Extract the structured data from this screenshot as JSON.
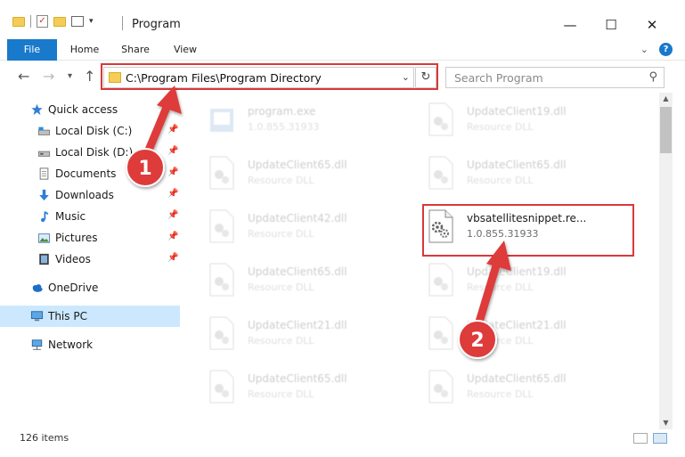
{
  "window": {
    "title": "Program",
    "minimize": "—",
    "maximize": "☐",
    "close": "✕"
  },
  "ribbon": {
    "tabs": [
      "File",
      "Home",
      "Share",
      "View"
    ]
  },
  "address": {
    "path": "C:\\Program Files\\Program Directory",
    "search_placeholder": "Search Program"
  },
  "sidebar": {
    "items": [
      {
        "label": "Quick access",
        "icon": "star-icon"
      },
      {
        "label": "Local Disk (C:)",
        "icon": "drive-icon"
      },
      {
        "label": "Local Disk (D:)",
        "icon": "drive-icon"
      },
      {
        "label": "Documents",
        "icon": "documents-icon"
      },
      {
        "label": "Downloads",
        "icon": "download-icon"
      },
      {
        "label": "Music",
        "icon": "music-icon"
      },
      {
        "label": "Pictures",
        "icon": "pictures-icon"
      },
      {
        "label": "Videos",
        "icon": "videos-icon"
      },
      {
        "label": "OneDrive",
        "icon": "cloud-icon"
      },
      {
        "label": "This PC",
        "icon": "computer-icon"
      },
      {
        "label": "Network",
        "icon": "network-icon"
      }
    ]
  },
  "files": {
    "left": [
      {
        "name": "program.exe",
        "sub": "1.0.855.31933"
      },
      {
        "name": "UpdateClient65.dll",
        "sub": "Resource DLL"
      },
      {
        "name": "UpdateClient42.dll",
        "sub": "Resource DLL"
      },
      {
        "name": "UpdateClient65.dll",
        "sub": "Resource DLL"
      },
      {
        "name": "UpdateClient21.dll",
        "sub": "Resource DLL"
      },
      {
        "name": "UpdateClient65.dll",
        "sub": "Resource DLL"
      }
    ],
    "right": [
      {
        "name": "UpdateClient19.dll",
        "sub": "Resource DLL"
      },
      {
        "name": "UpdateClient65.dll",
        "sub": "Resource DLL"
      },
      {
        "name": "vbsatellitesnippet.re...",
        "sub": "1.0.855.31933"
      },
      {
        "name": "UpdateClient19.dll",
        "sub": "Resource DLL"
      },
      {
        "name": "UpdateClient21.dll",
        "sub": "Resource DLL"
      },
      {
        "name": "UpdateClient65.dll",
        "sub": "Resource DLL"
      }
    ]
  },
  "status": {
    "count": "126 items"
  },
  "annotations": {
    "step1": "1",
    "step2": "2"
  },
  "colors": {
    "accent": "#1979ca",
    "highlight": "#d9383b",
    "selected": "#cce8ff"
  }
}
